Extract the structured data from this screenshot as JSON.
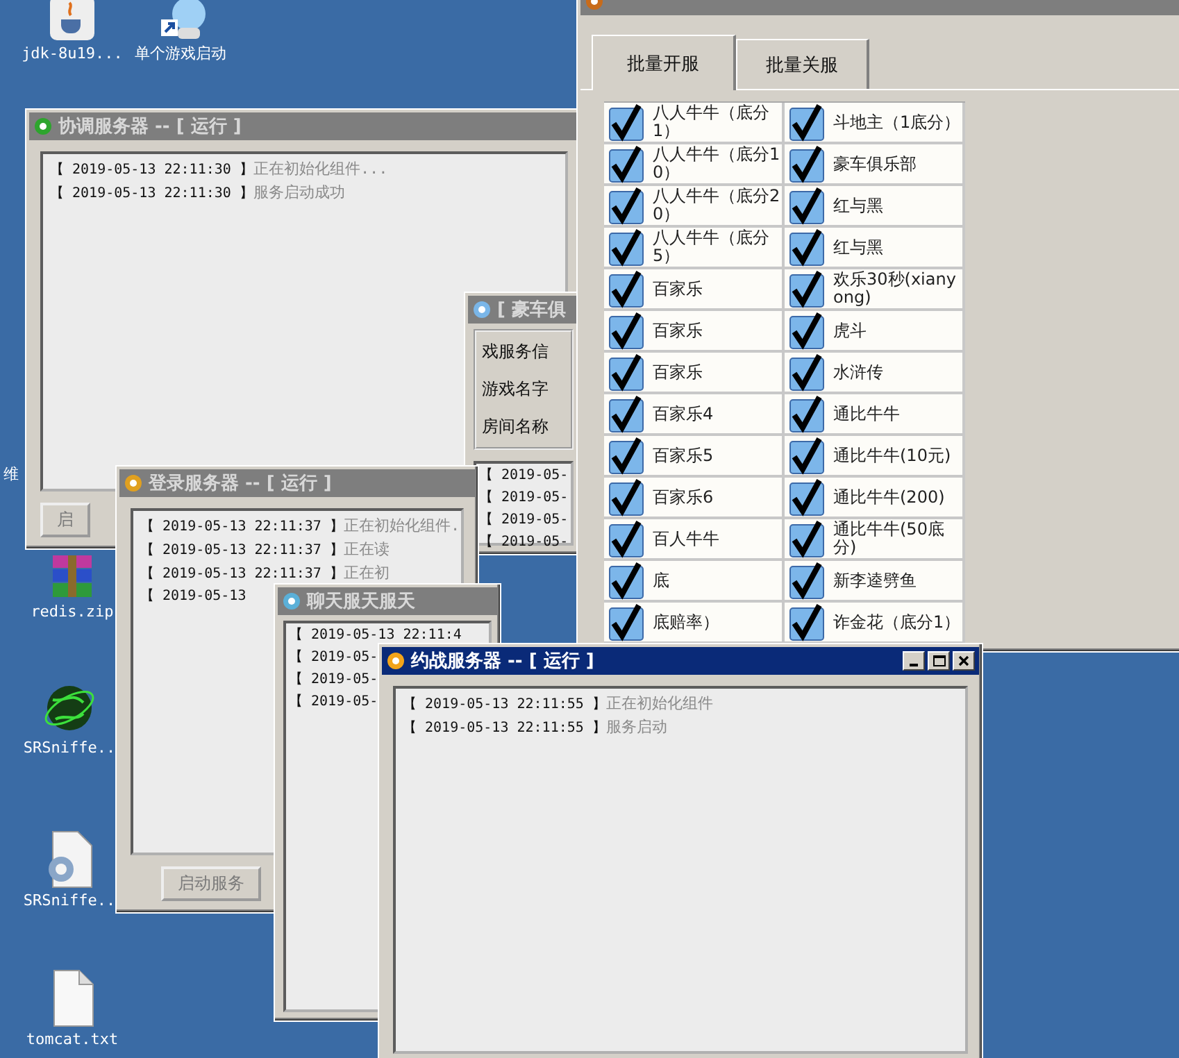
{
  "desktop_icons": [
    {
      "label": "jdk-8u19...",
      "kind": "java"
    },
    {
      "label": "单个游戏启动",
      "kind": "shortcut"
    },
    {
      "label": "维",
      "kind": "edge"
    },
    {
      "label": "redis.zip",
      "kind": "archive"
    },
    {
      "label": "SRSniffe..",
      "kind": "globe"
    },
    {
      "label": "SRSniffe..",
      "kind": "config"
    },
    {
      "label": "tomcat.txt",
      "kind": "text"
    }
  ],
  "windows": [
    {
      "kind": "log",
      "title": "协调服务器 -- [ 运行 ]",
      "active": false,
      "lines": [
        {
          "stamp": "【 2019-05-13 22:11:30 】",
          "message": "正在初始化组件..."
        },
        {
          "stamp": "【 2019-05-13 22:11:30 】",
          "message": "服务启动成功"
        }
      ],
      "button": "启"
    },
    {
      "kind": "room",
      "title": "[ 豪车俱",
      "active": false,
      "fields": [
        "戏服务信",
        "游戏名字",
        "房间名称"
      ],
      "lines": [
        {
          "stamp": "【 2019-05-"
        },
        {
          "stamp": "【 2019-05-"
        },
        {
          "stamp": "【 2019-05-"
        },
        {
          "stamp": "【 2019-05-"
        }
      ]
    },
    {
      "kind": "tool",
      "active": false,
      "tabs": [
        {
          "label": "批量开服",
          "selected": true
        },
        {
          "label": "批量关服",
          "selected": false
        }
      ],
      "items": [
        {
          "label": "八人牛牛（底分1）",
          "checked": true
        },
        {
          "label": "斗地主（1底分）",
          "checked": true
        },
        {
          "label": "八人牛牛（底分10）",
          "checked": true
        },
        {
          "label": "豪车俱乐部",
          "checked": true
        },
        {
          "label": "八人牛牛（底分20）",
          "checked": true
        },
        {
          "label": "红与黑",
          "checked": true
        },
        {
          "label": "八人牛牛（底分5）",
          "checked": true
        },
        {
          "label": "红与黑",
          "checked": true
        },
        {
          "label": "百家乐",
          "checked": true
        },
        {
          "label": "欢乐30秒(xianyong)",
          "checked": true
        },
        {
          "label": "百家乐",
          "checked": true
        },
        {
          "label": "虎斗",
          "checked": true
        },
        {
          "label": "百家乐",
          "checked": true
        },
        {
          "label": "水浒传",
          "checked": true
        },
        {
          "label": "百家乐4",
          "checked": true
        },
        {
          "label": "通比牛牛",
          "checked": true
        },
        {
          "label": "百家乐5",
          "checked": true
        },
        {
          "label": "通比牛牛(10元)",
          "checked": true
        },
        {
          "label": "百家乐6",
          "checked": true
        },
        {
          "label": "通比牛牛(200)",
          "checked": true
        },
        {
          "label": "百人牛牛",
          "checked": true
        },
        {
          "label": "通比牛牛(50底分)",
          "checked": true
        },
        {
          "label": "底",
          "checked": true
        },
        {
          "label": "新李逵劈鱼",
          "checked": true
        },
        {
          "label": "底赔率）",
          "checked": true
        },
        {
          "label": "诈金花（底分1）",
          "checked": true
        }
      ]
    },
    {
      "kind": "log",
      "title": "登录服务器 -- [ 运行 ]",
      "active": false,
      "lines": [
        {
          "stamp": "【 2019-05-13 22:11:37 】",
          "message": "正在初始化组件."
        },
        {
          "stamp": "【 2019-05-13 22:11:37 】",
          "message": "正在读"
        },
        {
          "stamp": "【 2019-05-13 22:11:37 】",
          "message": "正在初"
        },
        {
          "stamp": "【 2019-05-13"
        }
      ],
      "button": "启动服务"
    },
    {
      "kind": "log",
      "title": "聊天服天服天",
      "active": false,
      "lines": [
        {
          "stamp": "【 2019-05-13 22:11:4"
        },
        {
          "stamp": "【 2019-05-"
        },
        {
          "stamp": "【 2019-05-"
        },
        {
          "stamp": "【 2019-05-"
        }
      ]
    },
    {
      "kind": "log",
      "title": "约战服务器 -- [ 运行 ]",
      "active": true,
      "lines": [
        {
          "stamp": "【 2019-05-13 22:11:55 】",
          "message": "正在初始化组件"
        },
        {
          "stamp": "【 2019-05-13 22:11:55 】",
          "message": "服务启动"
        }
      ]
    }
  ]
}
